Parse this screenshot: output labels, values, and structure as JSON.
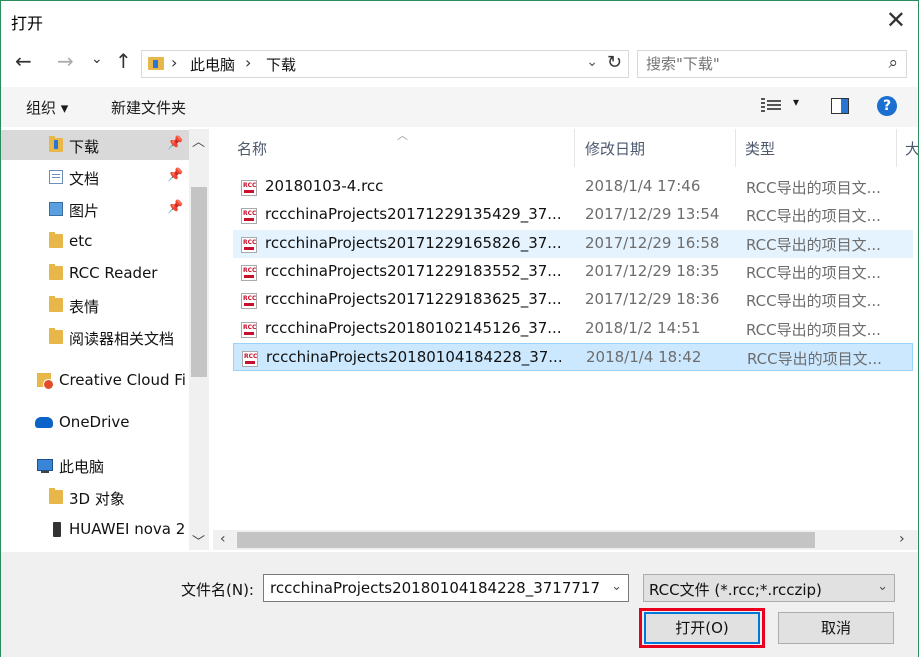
{
  "dialog": {
    "title": "打开"
  },
  "nav": {
    "back": "←",
    "forward": "→",
    "recent": "⌄",
    "up": "↑"
  },
  "address": {
    "crumbs": [
      "此电脑",
      "下载"
    ]
  },
  "search": {
    "placeholder": "搜索\"下载\""
  },
  "toolbar": {
    "organize": "组织 ▾",
    "new_folder": "新建文件夹",
    "help": "?"
  },
  "sidebar": {
    "items": [
      {
        "label": "下载",
        "icon": "download-folder-icon",
        "pinned": true,
        "selected": true
      },
      {
        "label": "文档",
        "icon": "documents-folder-icon",
        "pinned": true
      },
      {
        "label": "图片",
        "icon": "pictures-folder-icon",
        "pinned": true
      },
      {
        "label": "etc",
        "icon": "folder-icon"
      },
      {
        "label": "RCC Reader",
        "icon": "folder-icon"
      },
      {
        "label": "表情",
        "icon": "folder-icon"
      },
      {
        "label": "阅读器相关文档",
        "icon": "folder-icon"
      },
      {
        "label": "Creative Cloud Fi",
        "icon": "creative-cloud-icon"
      },
      {
        "label": "OneDrive",
        "icon": "onedrive-cloud-icon"
      },
      {
        "label": "此电脑",
        "icon": "this-pc-icon"
      },
      {
        "label": "3D 对象",
        "icon": "3d-objects-folder-icon"
      },
      {
        "label": "HUAWEI nova 2",
        "icon": "phone-icon"
      }
    ]
  },
  "columns": {
    "name": "名称",
    "date": "修改日期",
    "type": "类型",
    "size": "大"
  },
  "files": [
    {
      "name": "20180103-4.rcc",
      "date": "2018/1/4 17:46",
      "type": "RCC导出的项目文..."
    },
    {
      "name": "rccchinaProjects20171229135429_37...",
      "date": "2017/12/29 13:54",
      "type": "RCC导出的项目文..."
    },
    {
      "name": "rccchinaProjects20171229165826_37...",
      "date": "2017/12/29 16:58",
      "type": "RCC导出的项目文..."
    },
    {
      "name": "rccchinaProjects20171229183552_37...",
      "date": "2017/12/29 18:35",
      "type": "RCC导出的项目文..."
    },
    {
      "name": "rccchinaProjects20171229183625_37...",
      "date": "2017/12/29 18:36",
      "type": "RCC导出的项目文..."
    },
    {
      "name": "rccchinaProjects20180102145126_37...",
      "date": "2018/1/2 14:51",
      "type": "RCC导出的项目文..."
    },
    {
      "name": "rccchinaProjects20180104184228_37...",
      "date": "2018/1/4 18:42",
      "type": "RCC导出的项目文..."
    }
  ],
  "bottom": {
    "filename_label": "文件名(N):",
    "filename_value": "rccchinaProjects20180104184228_3717717",
    "filetype_value": "RCC文件 (*.rcc;*.rcczip)",
    "open_label": "打开(O)",
    "cancel_label": "取消"
  },
  "colors": {
    "accent": "#0078d7",
    "highlight": "#e8001c",
    "selected_row": "#cce8ff"
  }
}
